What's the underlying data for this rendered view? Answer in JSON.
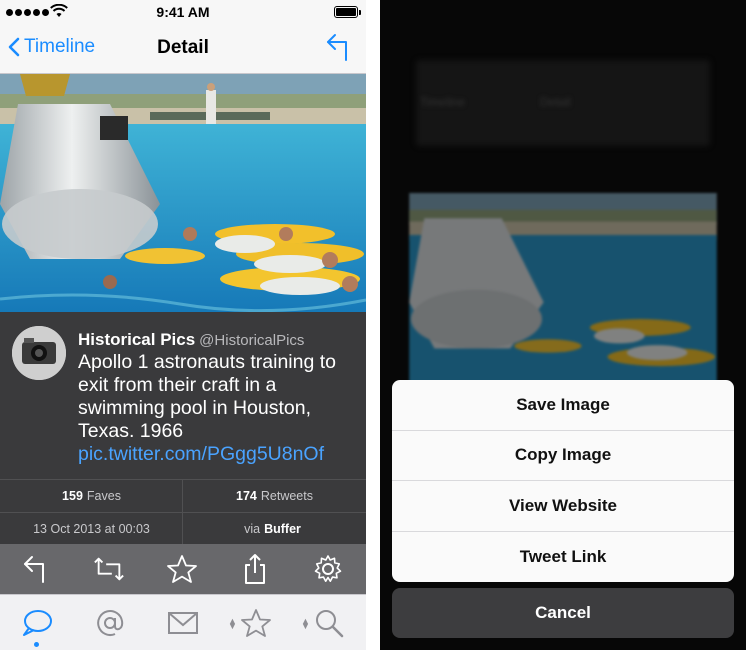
{
  "status": {
    "time": "9:41 AM"
  },
  "nav": {
    "back_label": "Timeline",
    "title": "Detail"
  },
  "tweet": {
    "name": "Historical Pics",
    "handle": "@HistoricalPics",
    "text": "Apollo 1 astronauts training to exit from their craft in a swimming pool in Houston, Texas. 1966 ",
    "link": "pic.twitter.com/PGgg5U8nOf"
  },
  "meta": {
    "faves_count": "159",
    "faves_label": "Faves",
    "retweets_count": "174",
    "retweets_label": "Retweets",
    "timestamp": "13 Oct 2013 at 00:03",
    "via_label": "via",
    "via_app": "Buffer"
  },
  "action_sheet": {
    "options": [
      "Save Image",
      "Copy Image",
      "View Website",
      "Tweet Link"
    ],
    "cancel": "Cancel"
  },
  "colors": {
    "accent": "#1a8cff",
    "tweet_bg": "#3a3a3c",
    "action_bar": "#68686b",
    "link": "#4aa3ff"
  },
  "icons": {
    "status": [
      "signal-dots-icon",
      "wifi-icon",
      "battery-icon"
    ],
    "toolbar": [
      "reply-icon",
      "retweet-icon",
      "favorite-star-icon",
      "share-icon",
      "settings-gear-icon"
    ],
    "tabbar": [
      "timeline-bubble-icon",
      "mentions-at-icon",
      "messages-envelope-icon",
      "favorites-star-icon",
      "search-magnifier-icon"
    ]
  }
}
